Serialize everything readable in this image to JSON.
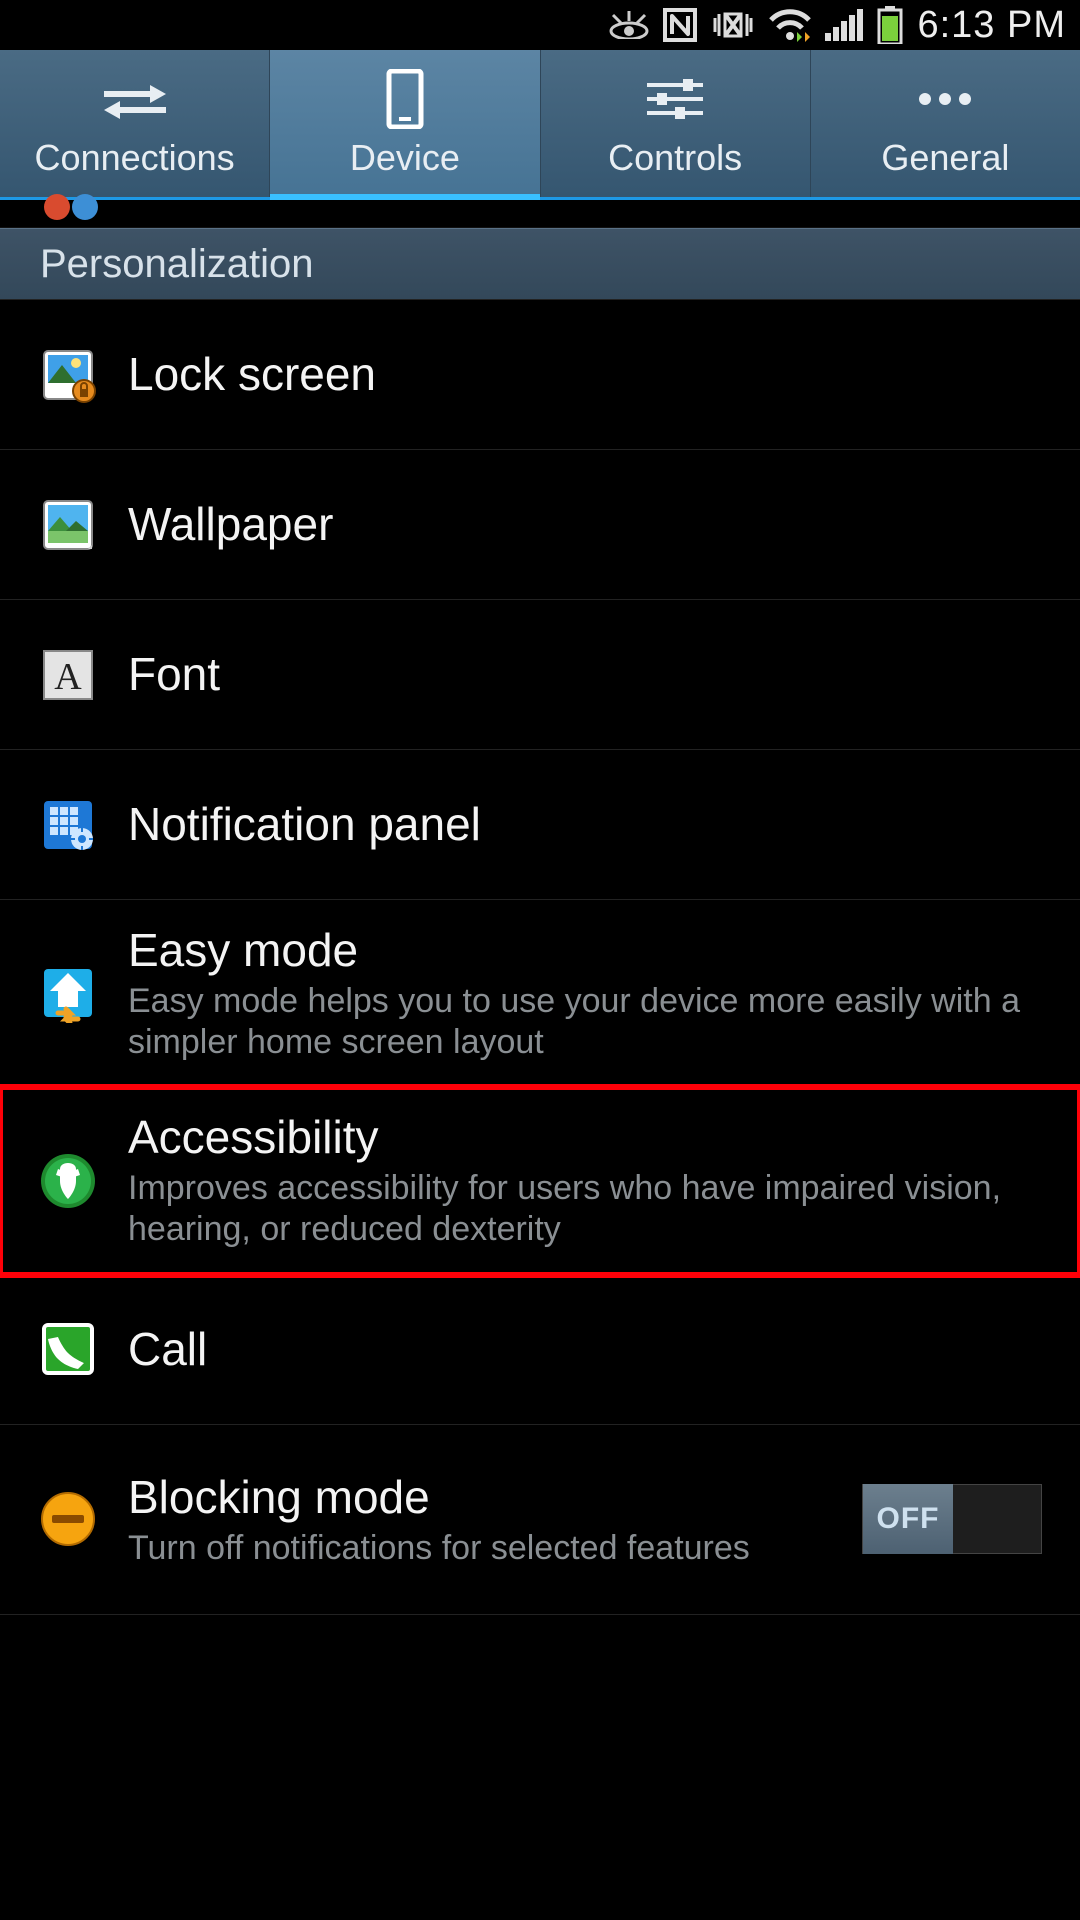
{
  "status": {
    "time": "6:13 PM"
  },
  "tabs": [
    {
      "label": "Connections"
    },
    {
      "label": "Device"
    },
    {
      "label": "Controls"
    },
    {
      "label": "General"
    }
  ],
  "active_tab_index": 1,
  "section": {
    "title": "Personalization"
  },
  "rows": {
    "lock": {
      "title": "Lock screen"
    },
    "wallpaper": {
      "title": "Wallpaper"
    },
    "font": {
      "title": "Font"
    },
    "notif": {
      "title": "Notification panel"
    },
    "easy": {
      "title": "Easy mode",
      "sub": "Easy mode helps you to use your device more easily with a simpler home screen layout"
    },
    "access": {
      "title": "Accessibility",
      "sub": "Improves accessibility for users who have impaired vision, hearing, or reduced dexterity"
    },
    "call": {
      "title": "Call"
    },
    "blocking": {
      "title": "Blocking mode",
      "sub": "Turn off notifications for selected features",
      "toggle": "OFF"
    }
  }
}
